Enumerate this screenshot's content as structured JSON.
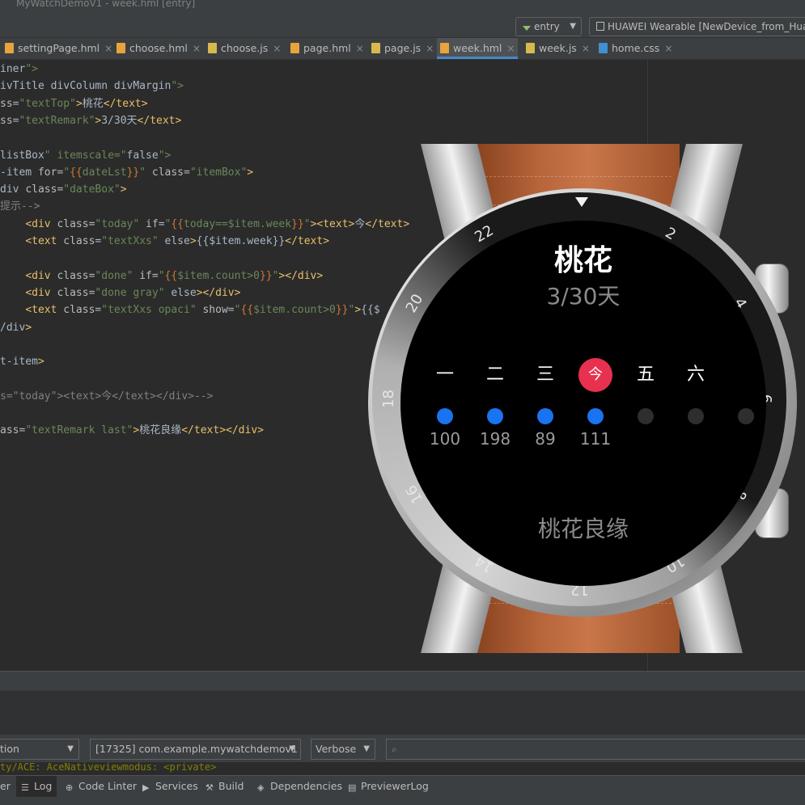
{
  "window": {
    "title": "MyWatchDemoV1 - week.hml [entry]"
  },
  "toolbar": {
    "module_select": "entry",
    "device_select": "HUAWEI Wearable [NewDevice_from_Huaw"
  },
  "tabs": [
    {
      "label": "settingPage.hml",
      "kind": "hml"
    },
    {
      "label": "choose.hml",
      "kind": "hml"
    },
    {
      "label": "choose.js",
      "kind": "js"
    },
    {
      "label": "page.hml",
      "kind": "hml"
    },
    {
      "label": "page.js",
      "kind": "js"
    },
    {
      "label": "week.hml",
      "kind": "hml",
      "active": true
    },
    {
      "label": "week.js",
      "kind": "js"
    },
    {
      "label": "home.css",
      "kind": "css"
    }
  ],
  "code_lines": [
    "iner\">",
    "ivTitle divColumn divMargin\">",
    "ss=\"textTop\">桃花</text>",
    "ss=\"textRemark\">3/30天</text>",
    "",
    "listBox\" itemscale=\"false\">",
    "-item for=\"{{dateLst}}\" class=\"itemBox\">",
    "div class=\"dateBox\">",
    "提示-->",
    "    <div class=\"today\" if=\"{{today==$item.week}}\"><text>今</text>",
    "    <text class=\"textXxs\" else>{{$item.week}}</text>",
    "",
    "    <div class=\"done\" if=\"{{$item.count>0}}\"></div>",
    "    <div class=\"done gray\" else></div>",
    "    <text class=\"textXxs opaci\" show=\"{{$item.count>0}}\">{{$",
    "/div>",
    "",
    "t-item>",
    "",
    "s=\"today\"><text>今</text></div>-->",
    "",
    "ass=\"textRemark last\">桃花良缘</text></div>"
  ],
  "watch": {
    "title": "桃花",
    "subtitle": "3/30天",
    "remark": "桃花良缘",
    "bezel_numbers": [
      "22",
      "2",
      "20",
      "4",
      "18",
      "6",
      "16",
      "8",
      "14",
      "10",
      "12"
    ],
    "days": [
      {
        "label": "一",
        "count": "100",
        "done": true
      },
      {
        "label": "二",
        "count": "198",
        "done": true
      },
      {
        "label": "三",
        "count": "89",
        "done": true
      },
      {
        "label": "今",
        "count": "111",
        "done": true,
        "today": true
      },
      {
        "label": "五",
        "count": "",
        "done": false
      },
      {
        "label": "六",
        "count": "",
        "done": false
      }
    ],
    "colors": {
      "done": "#1a73f0",
      "gray": "#2e2e2e",
      "today": "#e8314f"
    }
  },
  "logcat": {
    "process_select": "[17325] com.example.mywatchdemov1",
    "device_partial": "tion",
    "level_select": "Verbose",
    "search_placeholder": "",
    "log_line": "ty/ACE: AceNativeviewmodus: <private>"
  },
  "bottom_tabs": [
    {
      "label": "er",
      "icon": ""
    },
    {
      "label": "Log",
      "icon": "log-icon",
      "active": true
    },
    {
      "label": "Code Linter",
      "icon": "code-linter-icon"
    },
    {
      "label": "Services",
      "icon": "services-icon"
    },
    {
      "label": "Build",
      "icon": "build-icon"
    },
    {
      "label": "Dependencies",
      "icon": "dependencies-icon"
    },
    {
      "label": "PreviewerLog",
      "icon": "previewer-log-icon"
    }
  ]
}
